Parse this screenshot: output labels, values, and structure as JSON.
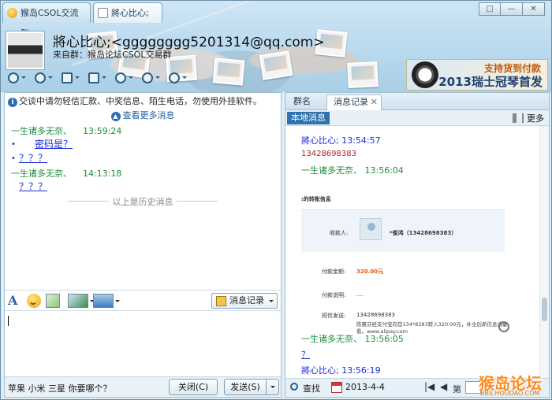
{
  "tabs": [
    {
      "label": "猴岛CSOL交流群"
    },
    {
      "label": "將心比心;"
    }
  ],
  "window_controls": {
    "restore": "□",
    "minimize": "—",
    "close": "✕"
  },
  "contact": {
    "name": "將心比心;<gggggggg5201314@qq.com>",
    "from": "来自群：猴岛论坛CSOL交易群"
  },
  "ad": {
    "line1": "支持货到付款",
    "line2": "2013瑞士冠琴首发"
  },
  "notice": "交谈中请勿轻信汇款、中奖信息、陌生电话，勿使用外挂软件。",
  "more_messages": "查看更多消息",
  "messages": [
    {
      "sender": "一生诸多无奈、",
      "time": "13:59:24",
      "lines": [
        "密码是？",
        "？？？"
      ]
    },
    {
      "sender": "一生诸多无奈、",
      "time": "14:13:18",
      "lines": [
        "？？？"
      ]
    }
  ],
  "history_separator": "以上是历史消息",
  "history_button": "消息记录",
  "bottom": {
    "ad_text": "苹果 小米 三星 你要哪个？",
    "close_button": "关闭(C)",
    "send_button": "发送(S)"
  },
  "right": {
    "tabs": [
      {
        "label": "群名片"
      },
      {
        "label": "消息记录"
      }
    ],
    "local_tag": "本地消息",
    "more": "更多",
    "log": [
      {
        "name": "將心比心; 13:54:57"
      },
      {
        "text": "13428698383"
      },
      {
        "name": "一生诸多无奈、 13:56:04"
      },
      {
        "name": "一生诸多无奈、 13:56:05"
      },
      {
        "text": "？"
      },
      {
        "name": "將心比心; 13:56:19"
      }
    ],
    "transfer": {
      "title": ":的转账信息",
      "payee_label": "收款人:",
      "payee_value": "*俊鸿（13428698383）",
      "amount_label": "付款金额:",
      "amount_value": "320.00元",
      "remark_label": "付款说明:",
      "remark_value": "....",
      "sms_label": "短信发送:",
      "sms_value": "13428698383",
      "remark_long": "陈晨芬经支付宝向您134*8383转入320.00元，补全后新信息请查看。www.alipay.com"
    },
    "footer": {
      "search": "查找",
      "date": "2013-4-4",
      "page_label": "第"
    }
  },
  "watermark": {
    "top": "猴岛论坛",
    "url": "BBS.HOUDAO.COM"
  },
  "colors": {
    "green_name": "#1e8c3a",
    "blue_text": "#1a2bd9",
    "accent": "#2f72ad"
  }
}
